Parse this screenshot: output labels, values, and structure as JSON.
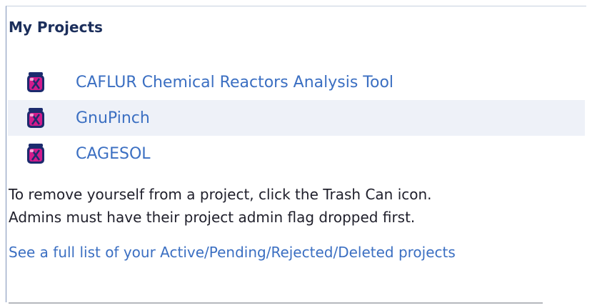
{
  "section": {
    "title": "My Projects"
  },
  "projects": [
    {
      "name": "CAFLUR Chemical Reactors Analysis Tool",
      "icon": "trash-can-icon"
    },
    {
      "name": "GnuPinch",
      "icon": "trash-can-icon"
    },
    {
      "name": "CAGESOL",
      "icon": "trash-can-icon"
    }
  ],
  "instructions": {
    "line1": "To remove yourself from a project, click the Trash Can icon.",
    "line2": "Admins must have their project admin flag dropped first."
  },
  "links": {
    "full_list": "See a full list of your Active/Pending/Rejected/Deleted projects"
  },
  "colors": {
    "link": "#3b6fc2",
    "title": "#1b2e5b",
    "alt_row": "#eef1f8",
    "trash_magenta": "#d21b8c",
    "trash_navy": "#1c2b6e"
  }
}
